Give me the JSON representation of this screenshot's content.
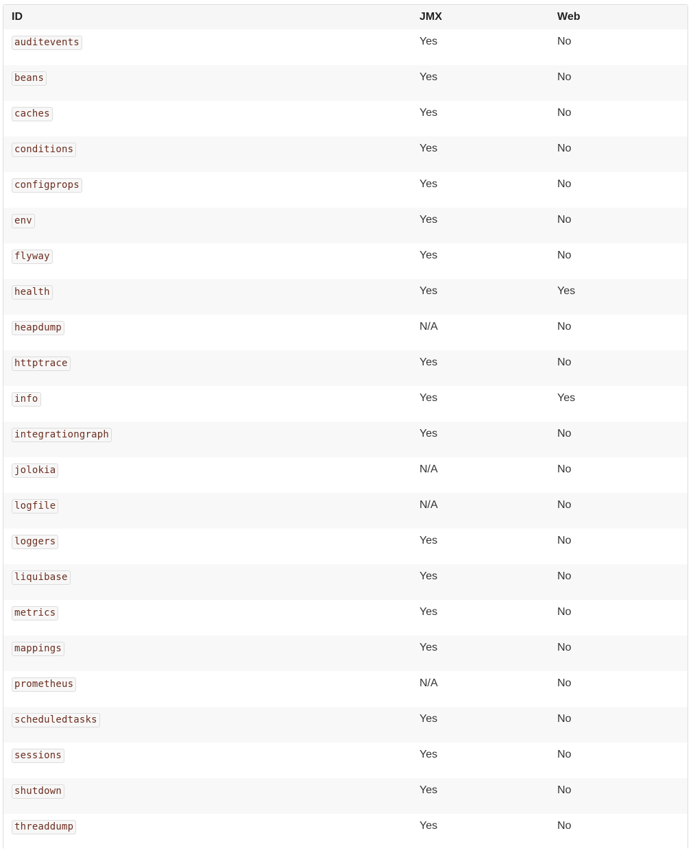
{
  "table": {
    "headers": {
      "id": "ID",
      "jmx": "JMX",
      "web": "Web"
    },
    "rows": [
      {
        "id": "auditevents",
        "jmx": "Yes",
        "web": "No"
      },
      {
        "id": "beans",
        "jmx": "Yes",
        "web": "No"
      },
      {
        "id": "caches",
        "jmx": "Yes",
        "web": "No"
      },
      {
        "id": "conditions",
        "jmx": "Yes",
        "web": "No"
      },
      {
        "id": "configprops",
        "jmx": "Yes",
        "web": "No"
      },
      {
        "id": "env",
        "jmx": "Yes",
        "web": "No"
      },
      {
        "id": "flyway",
        "jmx": "Yes",
        "web": "No"
      },
      {
        "id": "health",
        "jmx": "Yes",
        "web": "Yes"
      },
      {
        "id": "heapdump",
        "jmx": "N/A",
        "web": "No"
      },
      {
        "id": "httptrace",
        "jmx": "Yes",
        "web": "No"
      },
      {
        "id": "info",
        "jmx": "Yes",
        "web": "Yes"
      },
      {
        "id": "integrationgraph",
        "jmx": "Yes",
        "web": "No"
      },
      {
        "id": "jolokia",
        "jmx": "N/A",
        "web": "No"
      },
      {
        "id": "logfile",
        "jmx": "N/A",
        "web": "No"
      },
      {
        "id": "loggers",
        "jmx": "Yes",
        "web": "No"
      },
      {
        "id": "liquibase",
        "jmx": "Yes",
        "web": "No"
      },
      {
        "id": "metrics",
        "jmx": "Yes",
        "web": "No"
      },
      {
        "id": "mappings",
        "jmx": "Yes",
        "web": "No"
      },
      {
        "id": "prometheus",
        "jmx": "N/A",
        "web": "No"
      },
      {
        "id": "scheduledtasks",
        "jmx": "Yes",
        "web": "No"
      },
      {
        "id": "sessions",
        "jmx": "Yes",
        "web": "No"
      },
      {
        "id": "shutdown",
        "jmx": "Yes",
        "web": "No"
      },
      {
        "id": "threaddump",
        "jmx": "Yes",
        "web": "No"
      }
    ]
  },
  "colors": {
    "header_bg": "#f6f6f6",
    "stripe_bg": "#f8f8f8",
    "code_text": "#6b2d1f",
    "border": "#dddddd"
  }
}
